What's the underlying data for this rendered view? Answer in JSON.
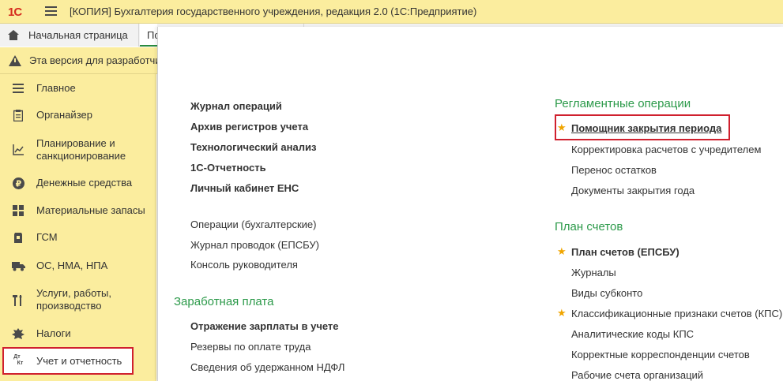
{
  "titlebar": {
    "logo_text": "1С",
    "title": "[КОПИЯ] Бухгалтерия государственного учреждения, редакция 2.0  (1С:Предприятие)"
  },
  "tabs": {
    "home_label": "Начальная страница",
    "active_label": "По"
  },
  "warning": {
    "text": "Эта версия для разработчи"
  },
  "sidebar": {
    "items": [
      {
        "label": "Главное",
        "icon": "list-icon"
      },
      {
        "label": "Органайзер",
        "icon": "clipboard-icon"
      },
      {
        "label": "Планирование и",
        "label2": "санкционирование",
        "icon": "chart-icon"
      },
      {
        "label": "Денежные средства",
        "icon": "ruble-icon"
      },
      {
        "label": "Материальные запасы",
        "icon": "grid-icon"
      },
      {
        "label": "ГСМ",
        "icon": "fuel-icon"
      },
      {
        "label": "ОС, НМА, НПА",
        "icon": "truck-icon"
      },
      {
        "label": "Услуги, работы,",
        "label2": "производство",
        "icon": "tools-icon"
      },
      {
        "label": "Налоги",
        "icon": "emblem-icon"
      },
      {
        "label": "Учет и отчетность",
        "icon": "dtkt-icon"
      }
    ],
    "dtkt_top": "Дт",
    "dtkt_bottom": "Кт"
  },
  "main": {
    "col1_bold": [
      "Журнал операций",
      "Архив регистров учета",
      "Технологический анализ",
      "1С-Отчетность",
      "Личный кабинет ЕНС"
    ],
    "col1_regular": [
      "Операции (бухгалтерские)",
      "Журнал проводок (ЕПСБУ)",
      "Консоль руководителя"
    ],
    "salary_header": "Заработная плата",
    "salary_bold": "Отражение зарплаты в учете",
    "salary_regular": [
      "Резервы по оплате труда",
      "Сведения об удержанном НДФЛ"
    ],
    "reg_header": "Регламентные операции",
    "reg_items": [
      "Помощник закрытия периода",
      "Корректировка расчетов с учредителем",
      "Перенос остатков",
      "Документы закрытия года"
    ],
    "plan_header": "План счетов",
    "plan_items": [
      "План счетов (ЕПСБУ)",
      "Журналы",
      "Виды субконто",
      "Классификационные признаки счетов (КПС)",
      "Аналитические коды КПС",
      "Корректные корреспонденции счетов",
      "Рабочие счета организаций"
    ]
  },
  "colors": {
    "accent_yellow": "#fbed9e",
    "section_green": "#2c9a4a",
    "highlight_red": "#d0202e",
    "star": "#f0a500"
  }
}
